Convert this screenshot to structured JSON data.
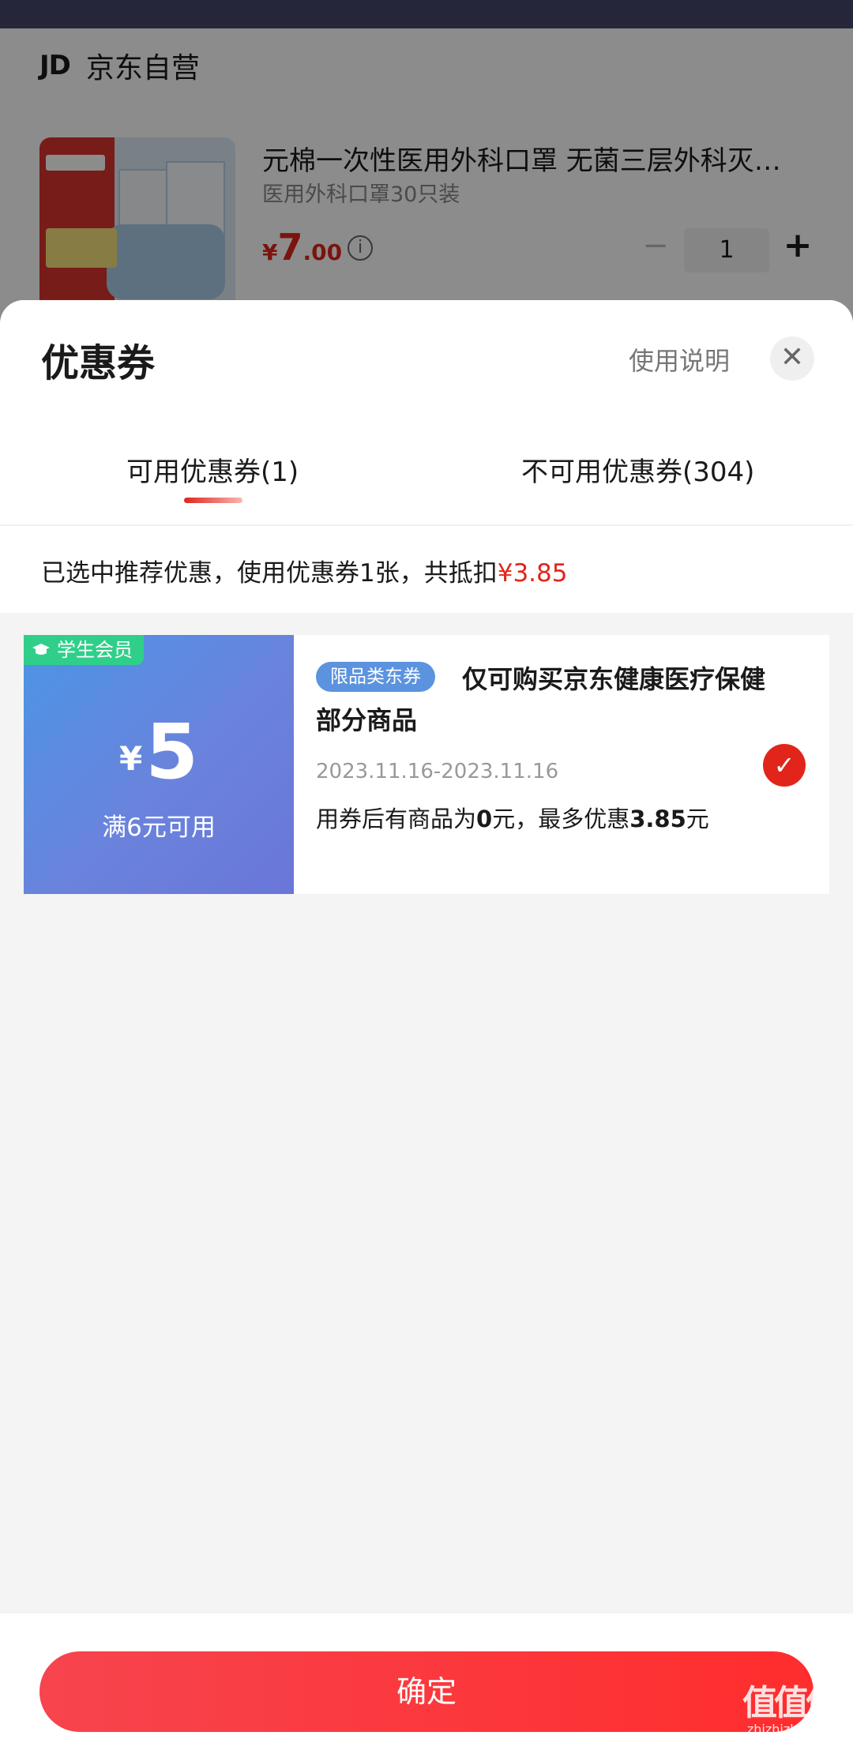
{
  "background_page": {
    "store": {
      "logo": "JD",
      "name": "京东自营"
    },
    "product": {
      "title": "元棉一次性医用外科口罩 无菌三层外科灭…",
      "subtitle": "医用外科口罩30只装",
      "price": {
        "currency": "¥",
        "integer": "7",
        "decimal": ".00"
      },
      "quantity": "1",
      "minus_label": "−",
      "plus_label": "+"
    }
  },
  "sheet": {
    "title": "优惠券",
    "usage_link": "使用说明",
    "close_label": "✕",
    "tabs": [
      {
        "label": "可用优惠券(1)",
        "active": true
      },
      {
        "label": "不可用优惠券(304)",
        "active": false
      }
    ],
    "summary": {
      "text": "已选中推荐优惠，使用优惠券1张，共抵扣",
      "amount": "¥3.85"
    },
    "coupons": [
      {
        "tag": "学生会员",
        "currency": "¥",
        "value": "5",
        "condition": "满6元可用",
        "type_tag": "限品类东券",
        "description": "仅可购买京东健康医疗保健部分商品",
        "date_range": "2023.11.16-2023.11.16",
        "note_prefix": "用券后有商品为",
        "note_zero": "0",
        "note_mid": "元，最多优惠",
        "note_max": "3.85",
        "note_suffix": "元",
        "selected": true
      }
    ],
    "confirm_label": "确定"
  },
  "watermark": {
    "main": "值值值",
    "sub": "zhizhizhi.com"
  },
  "colors": {
    "accent_red": "#e1251b",
    "coupon_blue": "#5b8ee0",
    "student_green": "#2fcf8a"
  }
}
